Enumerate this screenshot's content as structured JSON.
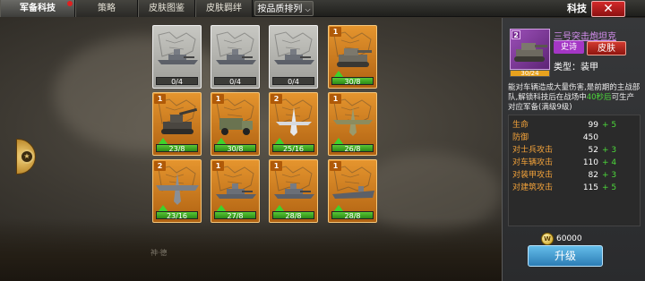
{
  "tabs": [
    {
      "label": "军备科技",
      "active": true,
      "badge": true
    },
    {
      "label": "策略",
      "active": false
    },
    {
      "label": "皮肤图鉴",
      "active": false
    },
    {
      "label": "皮肤羁绊",
      "active": false
    }
  ],
  "sort_dropdown": {
    "label": "按品质排列",
    "icon": "chevron-down-icon"
  },
  "header_title": "科技",
  "close_icon": "close-icon",
  "side_handle_icon": "rank-medal-icon",
  "cards": [
    {
      "name": "warship-locked-1",
      "kind": "ship",
      "locked": true,
      "level": "",
      "progress": "0/4"
    },
    {
      "name": "warship-locked-2",
      "kind": "ship",
      "locked": true,
      "level": "",
      "progress": "0/4"
    },
    {
      "name": "warship-locked-3",
      "kind": "ship",
      "locked": true,
      "level": "",
      "progress": "0/4"
    },
    {
      "name": "heavy-tank",
      "kind": "tank",
      "locked": false,
      "level": "1",
      "progress": "30/8"
    },
    {
      "name": "artillery-tank",
      "kind": "spg",
      "locked": false,
      "level": "1",
      "progress": "23/8"
    },
    {
      "name": "military-truck",
      "kind": "truck",
      "locked": false,
      "level": "1",
      "progress": "30/8"
    },
    {
      "name": "white-fighter-plane",
      "kind": "jet",
      "locked": false,
      "level": "2",
      "progress": "25/16"
    },
    {
      "name": "green-bomber-plane",
      "kind": "bomber",
      "locked": false,
      "level": "1",
      "progress": "26/8"
    },
    {
      "name": "heavy-bomber-plane",
      "kind": "heavy",
      "locked": false,
      "level": "2",
      "progress": "23/16"
    },
    {
      "name": "cruiser-ship",
      "kind": "ship",
      "locked": false,
      "level": "1",
      "progress": "27/8"
    },
    {
      "name": "destroyer-ship",
      "kind": "ship",
      "locked": false,
      "level": "1",
      "progress": "28/8"
    },
    {
      "name": "carrier-ship",
      "kind": "carrier",
      "locked": false,
      "level": "1",
      "progress": "28/8"
    }
  ],
  "detail": {
    "level": "2",
    "name": "三号突击炮坦克",
    "progress": "30/24",
    "progress_fraction": 1.0,
    "rarity": "史诗",
    "skin_button": "皮肤",
    "type": "类型：装甲",
    "desc_before": "能对车辆造成大量伤害,是前期的主战部队,解锁科技后在战场中",
    "desc_highlight": "40秒后",
    "desc_after": "可生产对应军备(满级9级)",
    "stats": [
      {
        "label": "生命",
        "value": "99",
        "plus": "+ 5"
      },
      {
        "label": "防御",
        "value": "450",
        "plus": ""
      },
      {
        "label": "对士兵攻击",
        "value": "52",
        "plus": "+ 3"
      },
      {
        "label": "对车辆攻击",
        "value": "110",
        "plus": "+ 4"
      },
      {
        "label": "对装甲攻击",
        "value": "82",
        "plus": "+ 3"
      },
      {
        "label": "对建筑攻击",
        "value": "115",
        "plus": "+ 5"
      }
    ],
    "coin_icon": "gold-coin-icon",
    "coin_icon_text": "W",
    "cost": "60000",
    "upgrade_label": "升级"
  },
  "footer_faint": "神·德"
}
